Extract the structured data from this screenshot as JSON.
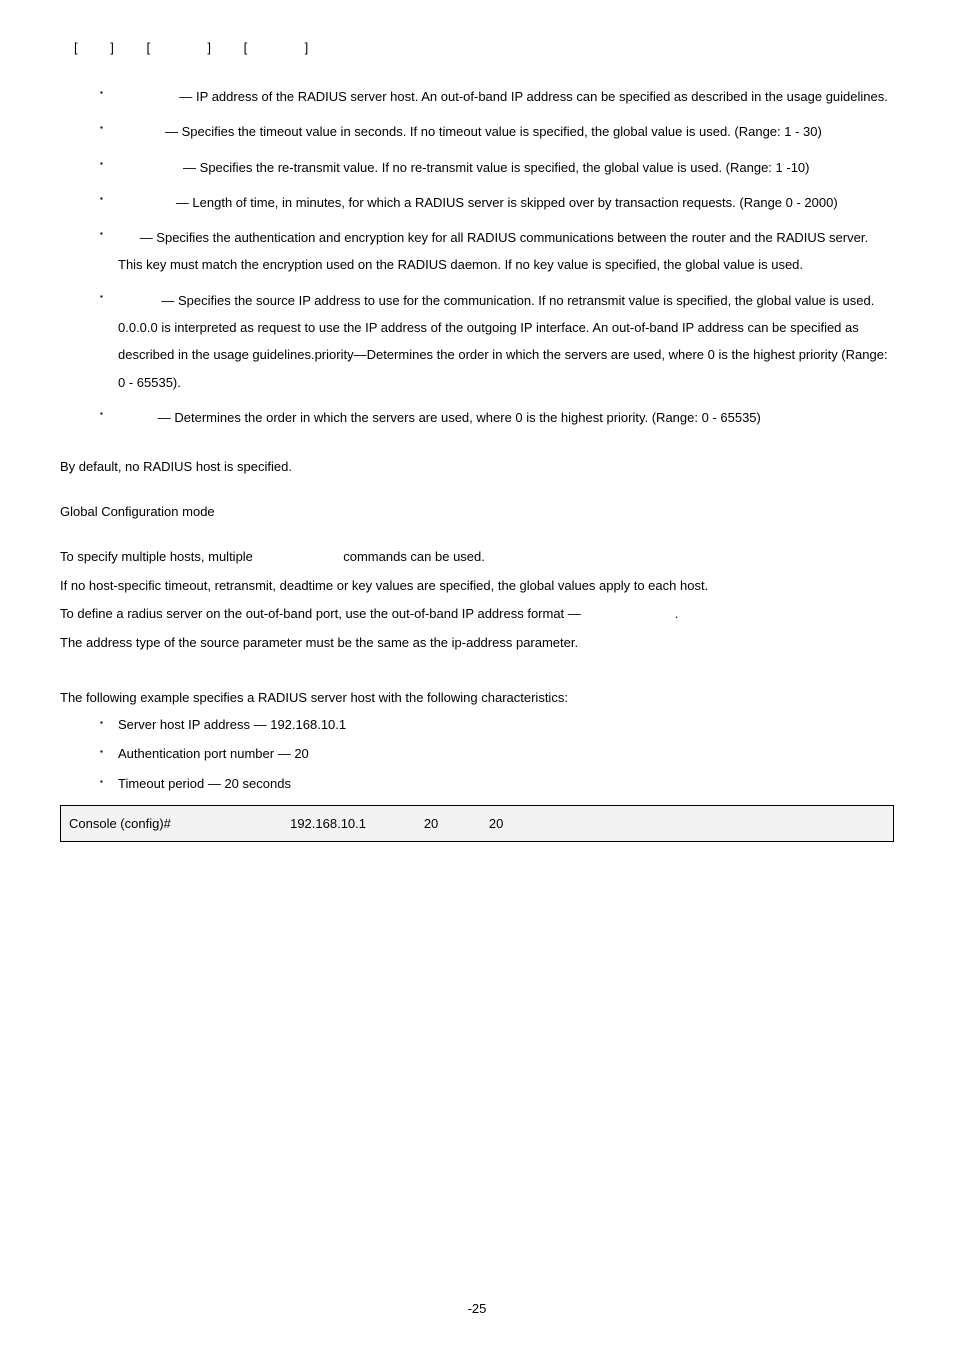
{
  "syntax": {
    "open1": "[",
    "close1": "]",
    "open2": "[",
    "close2": "]",
    "open3": "[",
    "close3": "]"
  },
  "params": [
    {
      "name": "",
      "text": "— IP address of the RADIUS server host. An out-of-band IP address can be specified as described in the usage guidelines."
    },
    {
      "name": "",
      "text": "— Specifies the timeout value in seconds. If no timeout value is specified, the global value is used. (Range: 1 - 30)"
    },
    {
      "name": "",
      "text": "— Specifies the re-transmit value. If no re-transmit value is specified, the global value is used. (Range: 1 -10)"
    },
    {
      "name": "",
      "text": "— Length of time, in minutes, for which a RADIUS server is skipped over by transaction requests. (Range 0 - 2000)"
    },
    {
      "name": "",
      "text": "— Specifies the authentication and encryption key for all RADIUS communications between the router and the RADIUS server. This key must match the encryption used on the RADIUS daemon. If no key value is specified, the global value is used."
    },
    {
      "name": "",
      "text": "— Specifies the source IP address to use for the communication. If no retransmit value is specified, the global value is used. 0.0.0.0 is interpreted as request to use the IP address of the outgoing IP interface. An out-of-band IP address can be specified as described in the usage guidelines.priority—Determines the order in which the servers are used, where 0 is the highest priority (Range: 0 - 65535)."
    },
    {
      "name": "",
      "text": "— Determines the order in which the servers are used, where 0 is the highest priority. (Range: 0 - 65535)"
    }
  ],
  "default_text": "By default, no RADIUS host is specified.",
  "mode_text": "Global Configuration mode",
  "guidelines": {
    "line1_a": "To specify multiple hosts, multiple ",
    "line1_b": " commands can be used.",
    "line2": "If no host-specific timeout, retransmit, deadtime or key values are specified, the global values apply to each host.",
    "line3_a": "To define a radius server on the out-of-band port, use the out-of-band IP address format — ",
    "line3_b": ".",
    "line4": "The address type of the source parameter must be the same as the ip-address parameter."
  },
  "example_intro": "The following example specifies a RADIUS server host with the following characteristics:",
  "example_bullets": [
    "Server host IP address — 192.168.10.1",
    "Authentication port number — 20",
    "Timeout period — 20 seconds"
  ],
  "code": {
    "prompt": "Console (config)# ",
    "ip": " 192.168.10.1 ",
    "port": " 20 ",
    "timeout": " 20"
  },
  "footer": "-25"
}
